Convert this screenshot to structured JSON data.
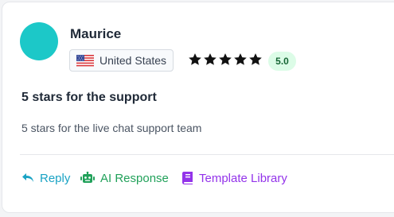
{
  "review": {
    "reviewer_name": "Maurice",
    "country": "United States",
    "rating": 5,
    "rating_label": "5.0",
    "title": "5 stars for the support",
    "body": "5 stars for the live chat support team"
  },
  "actions": {
    "reply_label": "Reply",
    "ai_response_label": "AI Response",
    "template_library_label": "Template Library"
  },
  "colors": {
    "avatar": "#1cc8c8",
    "reply": "#1aa3c4",
    "ai_response": "#21a15a",
    "template_library": "#9333ea",
    "rating_badge_bg": "#dcfce7",
    "rating_badge_text": "#166534"
  },
  "icons": {
    "flag": "us-flag-icon",
    "star": "star-icon",
    "reply": "reply-arrow-icon",
    "ai_response": "robot-icon",
    "template_library": "book-icon"
  }
}
